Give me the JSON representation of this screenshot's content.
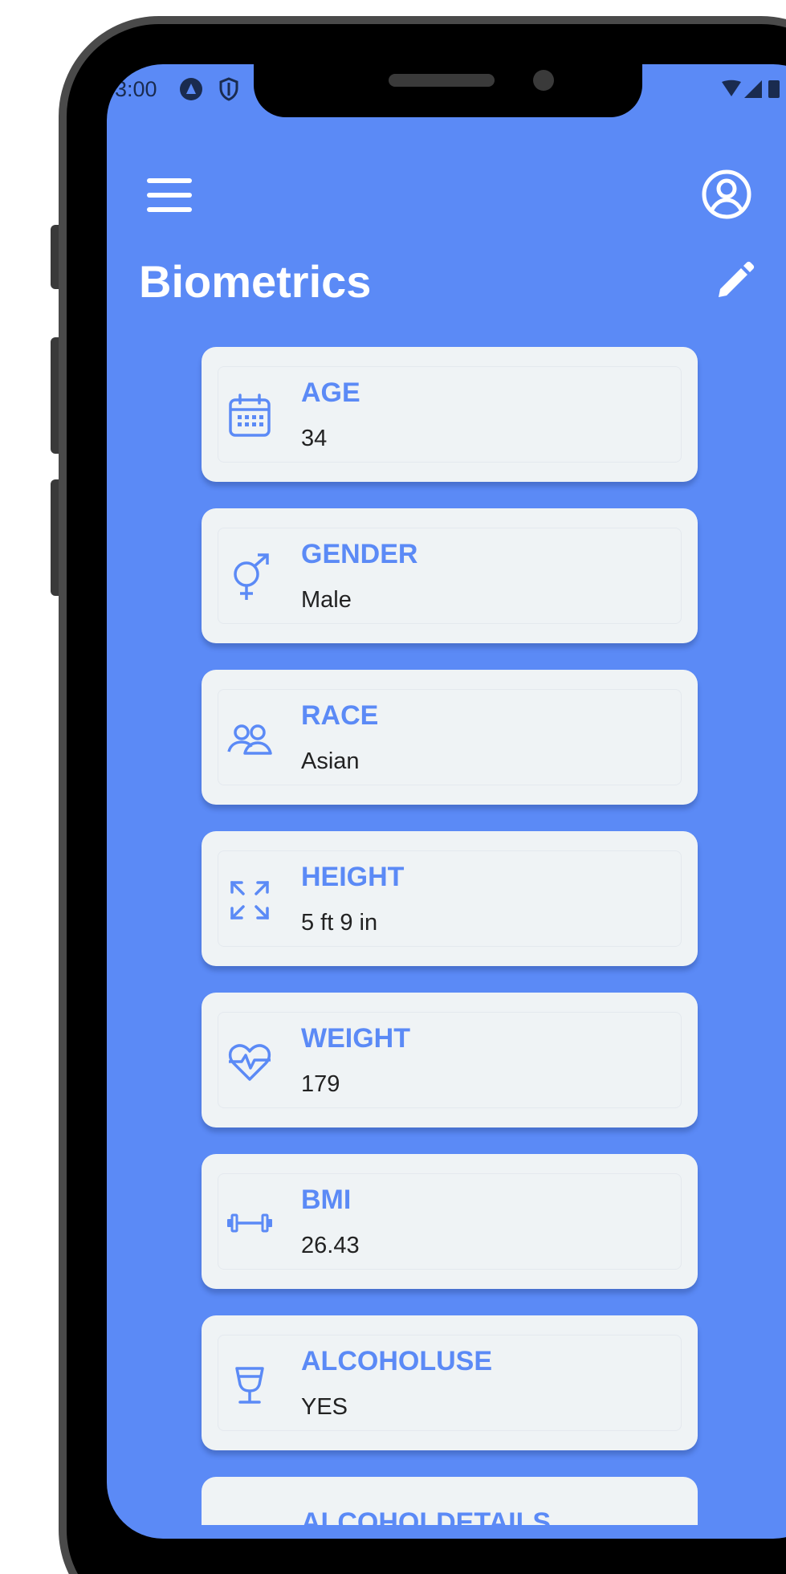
{
  "status_bar": {
    "time": "3:00"
  },
  "header": {
    "title": "Biometrics"
  },
  "colors": {
    "screen_background": "#5b8af6",
    "card_background": "#eff3f5",
    "accent": "#5b8af6",
    "value_text": "#222222"
  },
  "cards": [
    {
      "label": "AGE",
      "value": "34",
      "icon": "calendar-icon"
    },
    {
      "label": "GENDER",
      "value": "Male",
      "icon": "gender-icon"
    },
    {
      "label": "RACE",
      "value": "Asian",
      "icon": "people-icon"
    },
    {
      "label": "HEIGHT",
      "value": "5 ft 9 in",
      "icon": "expand-arrows-icon"
    },
    {
      "label": "WEIGHT",
      "value": "179",
      "icon": "heart-pulse-icon"
    },
    {
      "label": "BMI",
      "value": "26.43",
      "icon": "dumbbell-icon"
    },
    {
      "label": "ALCOHOLUSE",
      "value": "YES",
      "icon": "wine-glass-icon"
    },
    {
      "label": "ALCOHOLDETAILS",
      "value": "",
      "icon": ""
    }
  ]
}
